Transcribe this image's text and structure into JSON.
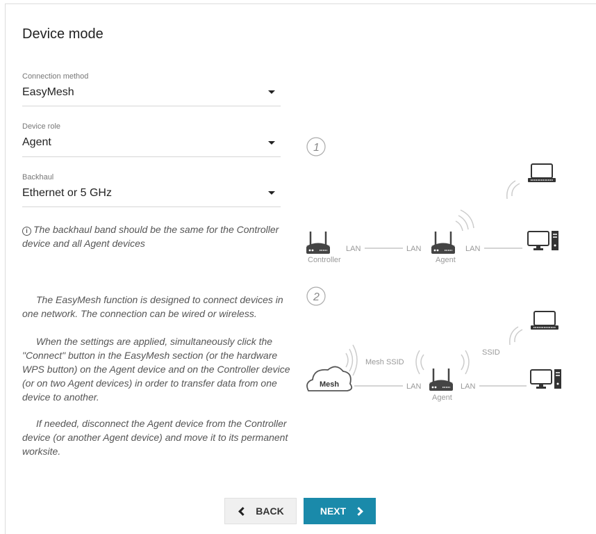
{
  "page": {
    "title": "Device mode"
  },
  "form": {
    "connection_method": {
      "label": "Connection method",
      "value": "EasyMesh"
    },
    "device_role": {
      "label": "Device role",
      "value": "Agent"
    },
    "backhaul": {
      "label": "Backhaul",
      "value": "Ethernet or 5 GHz"
    }
  },
  "note": {
    "icon": "info-icon",
    "text": "The backhaul band should be the same for the Controller device and all Agent devices"
  },
  "description": {
    "p1": "The EasyMesh function is designed to connect devices in one network. The connection can be wired or wireless.",
    "p2": "When the settings are applied, simultaneously click the \"Connect\" button in the EasyMesh section (or the hardware WPS button) on the Agent device and on the Controller device (or on two Agent devices) in order to transfer data from one device to another.",
    "p3": "If needed, disconnect the Agent device from the Controller device (or another Agent device) and move it to its permanent worksite."
  },
  "diagram": {
    "step1": {
      "number": "1",
      "controller_label": "Controller",
      "agent_label": "Agent",
      "lan1": "LAN",
      "lan2": "LAN",
      "lan3": "LAN"
    },
    "step2": {
      "number": "2",
      "cloud_label": "Mesh",
      "mesh_ssid": "Mesh SSID",
      "ssid": "SSID",
      "lan1": "LAN",
      "lan2": "LAN",
      "agent_label": "Agent"
    }
  },
  "buttons": {
    "back": "BACK",
    "next": "NEXT"
  },
  "colors": {
    "accent": "#1a8aaa"
  }
}
